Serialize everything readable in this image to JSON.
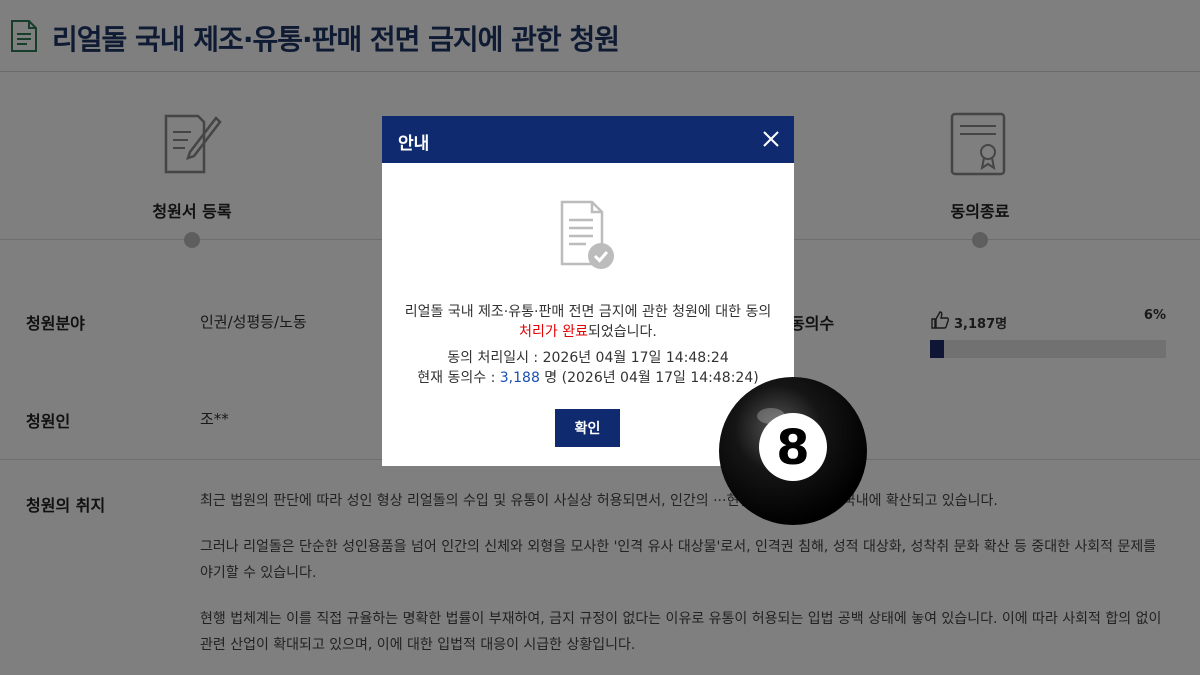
{
  "title": "리얼돌 국내 제조·유통·판매 전면 금지에 관한 청원",
  "steps": [
    {
      "label": "청원서 등록",
      "icon": "document-pen-icon"
    },
    {
      "label": "동의종료",
      "icon": "certificate-icon"
    }
  ],
  "info": {
    "field_label": "청원분야",
    "field_value": "인권/성평등/노동",
    "agree_label": "동의수",
    "agree_count": "3,187명",
    "agree_percent": "6%",
    "agree_progress": 0.06,
    "petitioner_label": "청원인",
    "petitioner_value": "조**",
    "purpose_label": "청원의 취지",
    "purpose_paragraphs": [
      "최근 법원의 판단에 따라 성인 형상 리얼돌의 수입 및 유통이 사실상 허용되면서, 인간의 ···현한 성적 대상물이 국내에 확산되고 있습니다.",
      "그러나 리얼돌은 단순한 성인용품을 넘어 인간의 신체와 외형을 모사한 '인격 유사 대상물'로서, 인격권 침해, 성적 대상화, 성착취 문화 확산 등 중대한 사회적 문제를 야기할 수 있습니다.",
      "현행 법체계는 이를 직접 규율하는 명확한 법률이 부재하여, 금지 규정이 없다는 이유로 유통이 허용되는 입법 공백 상태에 놓여 있습니다. 이에 따라 사회적 합의 없이 관련 산업이 확대되고 있으며, 이에 대한 입법적 대응이 시급한 상황입니다."
    ]
  },
  "modal": {
    "title": "안내",
    "message_before": "리얼돌 국내 제조·유통·판매 전면 금지에 관한 청원에 대한 동의 ",
    "message_highlight": "처리가 완료",
    "message_after": "되었습니다.",
    "processed_line": "동의 처리일시 : 2026년 04월 17일 14:48:24",
    "count_prefix": "현재 동의수 : ",
    "count_value": "3,188",
    "count_suffix": " 명 (2026년 04월 17일 14:48:24)",
    "confirm_label": "확인"
  },
  "colors": {
    "navy": "#0f2a6e",
    "title_blue": "#1f3466",
    "highlight_red": "#e60000",
    "count_blue": "#1a4fb0",
    "current_step_green": "#2f8a52"
  },
  "overlay_sticker": {
    "icon": "pool-8-ball-icon",
    "number": "8"
  }
}
